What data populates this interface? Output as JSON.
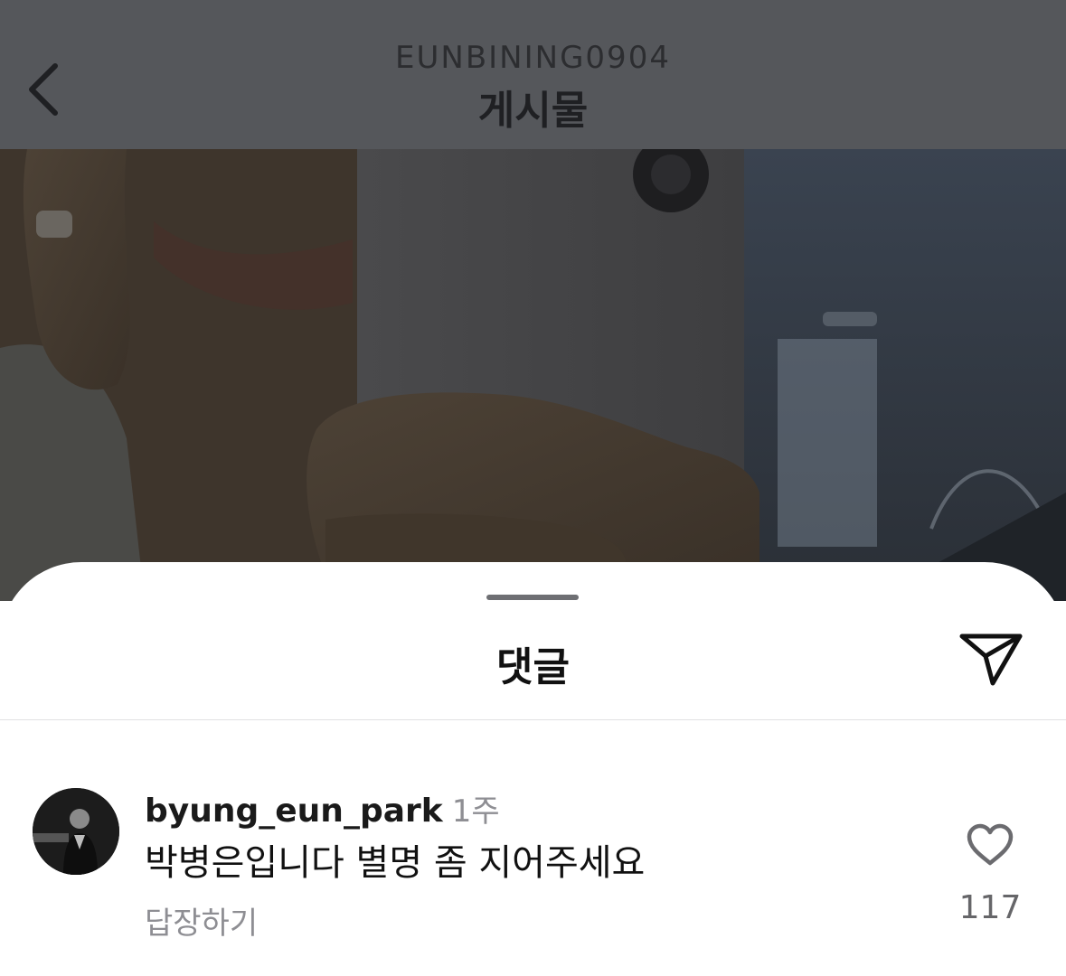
{
  "header": {
    "username": "EUNBINING0904",
    "title": "게시물",
    "back_icon": "chevron-left-icon"
  },
  "photo": {
    "description_icon": "post-photo"
  },
  "comments_sheet": {
    "title": "댓글",
    "share_icon": "paper-plane-icon",
    "comment": {
      "username": "byung_eun_park",
      "time": "1주",
      "text": "박병은입니다 별명 좀 지어주세요",
      "reply_label": "답장하기",
      "like_icon": "heart-outline-icon",
      "like_count": "117"
    }
  },
  "colors": {
    "header_bg": "#55575b",
    "sheet_bg": "#ffffff",
    "muted_text": "#8e8e93"
  }
}
